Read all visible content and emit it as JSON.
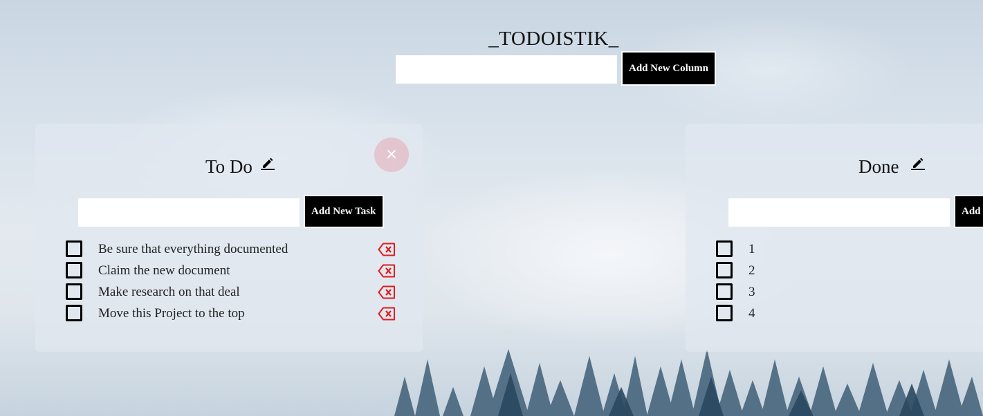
{
  "app": {
    "title": "_TODOISTIK_",
    "new_column_placeholder": "",
    "add_column_label": "Add New Column"
  },
  "columns": [
    {
      "title": "To Do",
      "add_task_label": "Add New Task",
      "task_placeholder": "",
      "tasks": [
        {
          "text": "Be sure that everything documented",
          "checked": false
        },
        {
          "text": "Claim the new document",
          "checked": false
        },
        {
          "text": "Make research on that deal",
          "checked": false
        },
        {
          "text": "Move this Project to the top",
          "checked": false
        }
      ]
    },
    {
      "title": "Done",
      "add_task_label": "Add New Task",
      "task_placeholder": "",
      "tasks": [
        {
          "text": "1",
          "checked": false
        },
        {
          "text": "2",
          "checked": false
        },
        {
          "text": "3",
          "checked": false
        },
        {
          "text": "4",
          "checked": false
        }
      ]
    }
  ],
  "icons": {
    "close": "close-icon",
    "edit": "pencil-icon",
    "delete": "backspace-delete-icon",
    "checkbox": "checkbox-icon"
  },
  "colors": {
    "button_bg": "#000000",
    "delete_icon": "#e01b1b",
    "close_button": "#e6aab4"
  }
}
